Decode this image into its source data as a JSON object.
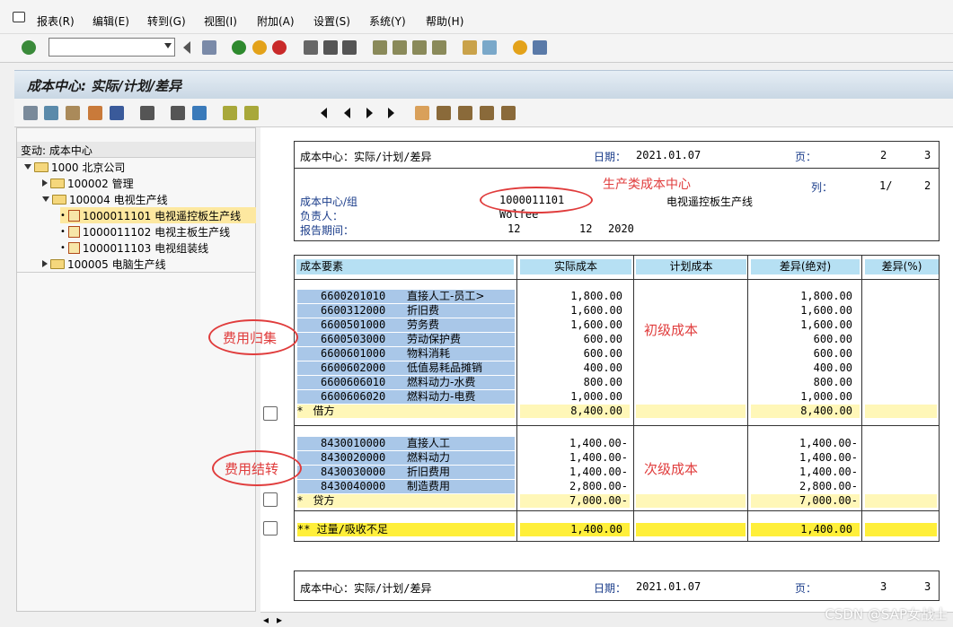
{
  "menu": [
    "报表(R)",
    "编辑(E)",
    "转到(G)",
    "视图(I)",
    "附加(A)",
    "设置(S)",
    "系统(Y)",
    "帮助(H)"
  ],
  "title": "成本中心: 实际/计划/差异",
  "tree": {
    "header": "变动:  成本中心",
    "items": [
      {
        "label": "1000 北京公司",
        "level": 0,
        "expand": "down",
        "icon": "folder-open"
      },
      {
        "label": "100002 管理",
        "level": 1,
        "expand": "right",
        "icon": "folder"
      },
      {
        "label": "100004 电视生产线",
        "level": 1,
        "expand": "down",
        "icon": "folder-open"
      },
      {
        "label": "1000011101 电视遥控板生产线",
        "level": 2,
        "expand": "dot",
        "icon": "leaf",
        "selected": true
      },
      {
        "label": "1000011102 电视主板生产线",
        "level": 2,
        "expand": "dot",
        "icon": "leaf"
      },
      {
        "label": "1000011103 电视组装线",
        "level": 2,
        "expand": "dot",
        "icon": "leaf"
      },
      {
        "label": "100005 电脑生产线",
        "level": 1,
        "expand": "right",
        "icon": "folder"
      }
    ]
  },
  "header": {
    "report_name": "成本中心：实际/计划/差异",
    "date_label": "日期：",
    "date": "2021.01.07",
    "page_label": "页：",
    "page": "2",
    "pages": "3",
    "col_label": "列：",
    "col": "1/",
    "cols": "2",
    "cc_label": "成本中心/组",
    "cc": "1000011101",
    "cc_name": "电视遥控板生产线",
    "resp_label": "负责人：",
    "resp": "Wolfee",
    "period_label": "报告期间：",
    "period_from": "12",
    "period_to": "12",
    "year": "2020",
    "annot_cc": "生产类成本中心"
  },
  "table": {
    "headers": [
      "成本要素",
      "实际成本",
      "计划成本",
      "差异(绝对)",
      "差异(%)"
    ],
    "debit_rows": [
      {
        "acct": "6600201010",
        "name": "直接人工-员工>",
        "actual": "1,800.00",
        "var": "1,800.00"
      },
      {
        "acct": "6600312000",
        "name": "折旧费",
        "actual": "1,600.00",
        "var": "1,600.00"
      },
      {
        "acct": "6600501000",
        "name": "劳务费",
        "actual": "1,600.00",
        "var": "1,600.00"
      },
      {
        "acct": "6600503000",
        "name": "劳动保护费",
        "actual": "600.00",
        "var": "600.00"
      },
      {
        "acct": "6600601000",
        "name": "物料消耗",
        "actual": "600.00",
        "var": "600.00"
      },
      {
        "acct": "6600602000",
        "name": "低值易耗品摊销",
        "actual": "400.00",
        "var": "400.00"
      },
      {
        "acct": "6600606010",
        "name": "燃料动力-水费",
        "actual": "800.00",
        "var": "800.00"
      },
      {
        "acct": "6600606020",
        "name": "燃料动力-电费",
        "actual": "1,000.00",
        "var": "1,000.00"
      }
    ],
    "debit_sum": {
      "label": "*   借方",
      "actual": "8,400.00",
      "var": "8,400.00"
    },
    "credit_rows": [
      {
        "acct": "8430010000",
        "name": "直接人工",
        "actual": "1,400.00-",
        "var": "1,400.00-"
      },
      {
        "acct": "8430020000",
        "name": "燃料动力",
        "actual": "1,400.00-",
        "var": "1,400.00-"
      },
      {
        "acct": "8430030000",
        "name": "折旧费用",
        "actual": "1,400.00-",
        "var": "1,400.00-"
      },
      {
        "acct": "8430040000",
        "name": "制造费用",
        "actual": "2,800.00-",
        "var": "2,800.00-"
      }
    ],
    "credit_sum": {
      "label": "*   贷方",
      "actual": "7,000.00-",
      "var": "7,000.00-"
    },
    "total": {
      "label": "** 过量/吸收不足",
      "actual": "1,400.00",
      "var": "1,400.00"
    }
  },
  "annotations": {
    "collect": "费用归集",
    "primary": "初级成本",
    "transfer": "费用结转",
    "secondary": "次级成本"
  },
  "footer": {
    "report_name": "成本中心：实际/计划/差异",
    "date_label": "日期：",
    "date": "2021.01.07",
    "page_label": "页：",
    "page": "3",
    "pages": "3"
  },
  "watermark": "CSDN @SAP女战士"
}
